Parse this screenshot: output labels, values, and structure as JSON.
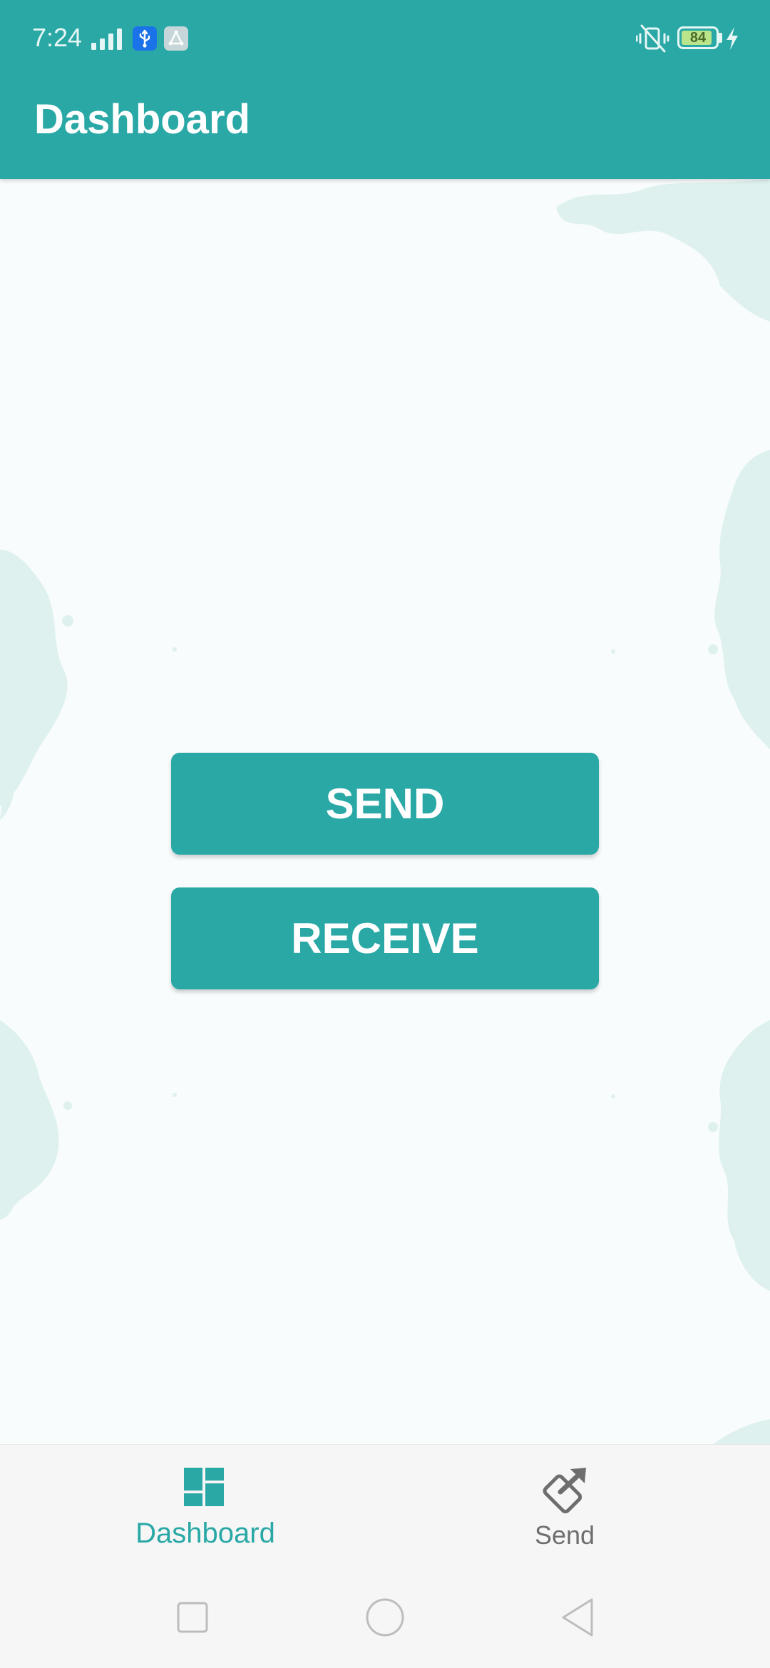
{
  "status_bar": {
    "time": "7:24",
    "battery_level": "84",
    "icons": [
      "signal-icon",
      "usb-icon",
      "gallery-icon",
      "mute-icon",
      "battery-icon",
      "charging-icon"
    ]
  },
  "app_bar": {
    "title": "Dashboard"
  },
  "actions": {
    "send_label": "SEND",
    "receive_label": "RECEIVE"
  },
  "bottom_nav": {
    "items": [
      {
        "label": "Dashboard",
        "icon": "dashboard-icon",
        "selected": true
      },
      {
        "label": "Send",
        "icon": "send-phone-icon",
        "selected": false
      }
    ]
  },
  "system_nav": {
    "icons": [
      "recent-apps-icon",
      "home-icon",
      "back-icon"
    ]
  },
  "colors": {
    "primary": "#29a8a6",
    "background": "#f8fcfc",
    "splatter": "#dff1ef",
    "inactive": "#6e6e6e"
  }
}
